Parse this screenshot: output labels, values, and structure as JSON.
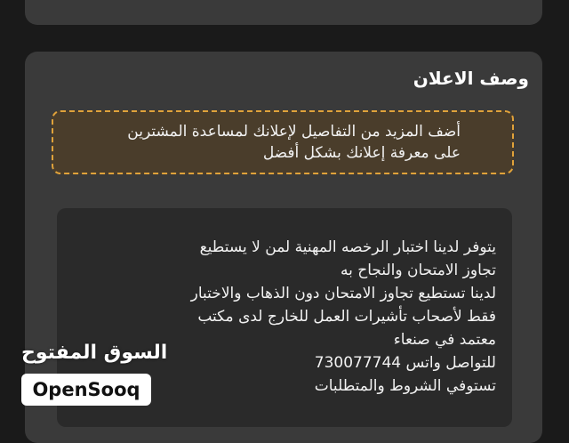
{
  "ad_description": {
    "title": "وصف الاعلان",
    "hint_lines": [
      "أضف المزيد من التفاصيل لإعلانك لمساعدة المشترين",
      "على معرفة إعلانك بشكل أفضل"
    ],
    "text_lines": [
      "يتوفر لدينا اختبار الرخصه المهنية لمن لا يستطيع",
      "تجاوز الامتحان والنجاح به",
      "لدينا تستطيع تجاوز الامتحان دون الذهاب والاختبار",
      "فقط لأصحاب تأشيرات العمل للخارج لدى مكتب",
      "معتمد في صنعاء",
      "للتواصل واتس 730077744",
      "تستوفي الشروط والمتطلبات"
    ]
  },
  "watermark": {
    "arabic": "السوق المفتوح",
    "latin": "OpenSooq"
  },
  "colors": {
    "background": "#1a1a1a",
    "card": "#3a3a3a",
    "hint_border": "#e0a23a",
    "hint_fill": "#4a3d2b",
    "text_area": "#2a2a2a"
  }
}
